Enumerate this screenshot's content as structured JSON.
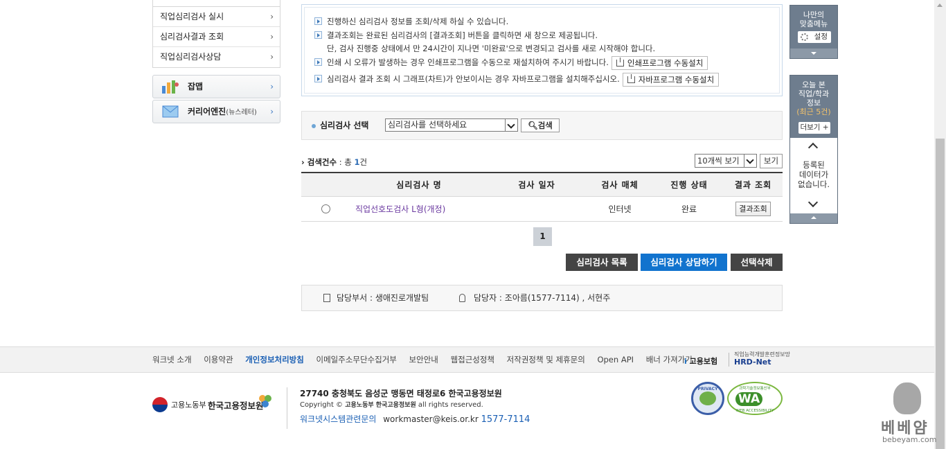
{
  "sidebar": {
    "items": [
      {
        "label": "직업심리검사 실시"
      },
      {
        "label": "심리검사결과 조회"
      },
      {
        "label": "직업심리검사상담"
      }
    ],
    "boxes": [
      {
        "label": "잡맵",
        "small": ""
      },
      {
        "label": "커리어엔진",
        "small": "(뉴스레터)"
      }
    ]
  },
  "notice": {
    "lines": [
      "진행하신 심리검사 정보를 조회/삭제 하실 수 있습니다.",
      "결과조회는 완료된 심리검사의 [결과조회] 버튼을 클릭하면 새 창으로 제공됩니다.",
      "단, 검사 진행중 상태에서 만 24시간이 지나면 '미완료'으로 변경되고 검사를 새로 시작해야 합니다.",
      "인쇄 시 오류가 발생하는 경우 인쇄프로그램을 수동으로 재설치하여 주시기 바랍니다.",
      "심리검사 결과 조회 시 그래프(차트)가 안보이시는 경우 자바프로그램을 설치해주십시오."
    ],
    "print_install_btn": "인쇄프로그램 수동설치",
    "java_install_btn": "자바프로그램 수동설치"
  },
  "search": {
    "label": "심리검사 선택",
    "select_value": "심리검사를 선택하세요",
    "button": "검색"
  },
  "results": {
    "count_label": "검색건수",
    "count_prefix": " : 총 ",
    "count_value": "1",
    "count_suffix": "건",
    "pagesize_value": "10개씩 보기",
    "view_btn": "보기",
    "columns": [
      "심리검사 명",
      "검사 일자",
      "검사 매체",
      "진행 상태",
      "결과 조회"
    ],
    "rows": [
      {
        "name": "직업선호도검사 L형(개정)",
        "date": "",
        "media": "인터넷",
        "status": "완료",
        "action": "결과조회"
      }
    ]
  },
  "pagination": {
    "current": "1"
  },
  "actions": {
    "list": "심리검사 목록",
    "counsel": "심리검사 상담하기",
    "delete": "선택삭제"
  },
  "contact": {
    "dept_label": "담당부서 : ",
    "dept_value": "생애진로개발팀",
    "person_label": "담당자 : ",
    "person_value": "조아름(1577-7114) , 서현주"
  },
  "quick": {
    "my_menu": "나만의\n맞춤메뉴",
    "settings": "설정",
    "recent_title": "오늘 본\n직업/학과\n정보",
    "recent_sub": "(최근 5건)",
    "more": "더보기 +",
    "empty": "등록된\n데이터가\n없습니다."
  },
  "footer": {
    "links": [
      "워크넷 소개",
      "이용약관",
      "개인정보처리방침",
      "이메일주소무단수집거부",
      "보안안내",
      "웹접근성정책",
      "저작권정책 및 제휴문의",
      "Open API",
      "배너 가져가기"
    ],
    "partner1": "고용보험",
    "partner2_small": "직업능력개발훈련정보망",
    "partner2": "HRD-Net",
    "ministry": "고용노동부",
    "org": "한국고용정보원",
    "address": "27740 충청북도 음성군 맹동면 태정로6 한국고용정보원",
    "copyright_prefix": "Copyright ©",
    "copyright_orgs": "고용노동부  한국고용정보원",
    "copyright_suffix": "all rights reserved.",
    "sys_label": "워크넷시스템관련문의",
    "email": "workmaster@keis.or.kr",
    "phone": "1577-7114",
    "badge1": "PRIVACY",
    "badge2": "WA",
    "badge2_top": "과학기술정보통신부",
    "badge2_bottom": "WEB ACCESSIBILITY"
  },
  "watermark": {
    "line1": "베베얌",
    "line2": "bebeyam.com"
  }
}
